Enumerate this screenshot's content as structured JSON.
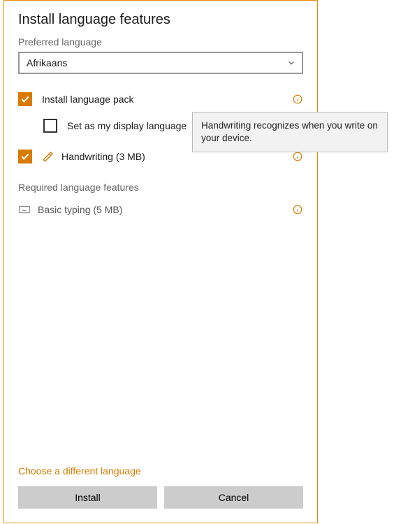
{
  "title": "Install language features",
  "preferred_label": "Preferred language",
  "language_selected": "Afrikaans",
  "features": {
    "pack": {
      "label": "Install language pack",
      "checked": true
    },
    "display": {
      "label": "Set as my display language",
      "checked": false
    },
    "handwriting": {
      "label": "Handwriting (3 MB)",
      "checked": true
    }
  },
  "required_label": "Required language features",
  "required": {
    "basic": {
      "label": "Basic typing (5 MB)"
    }
  },
  "link": "Choose a different language",
  "buttons": {
    "install": "Install",
    "cancel": "Cancel"
  },
  "tooltip_text": "Handwriting recognizes when you write on your device.",
  "colors": {
    "accent": "#d97a00"
  }
}
